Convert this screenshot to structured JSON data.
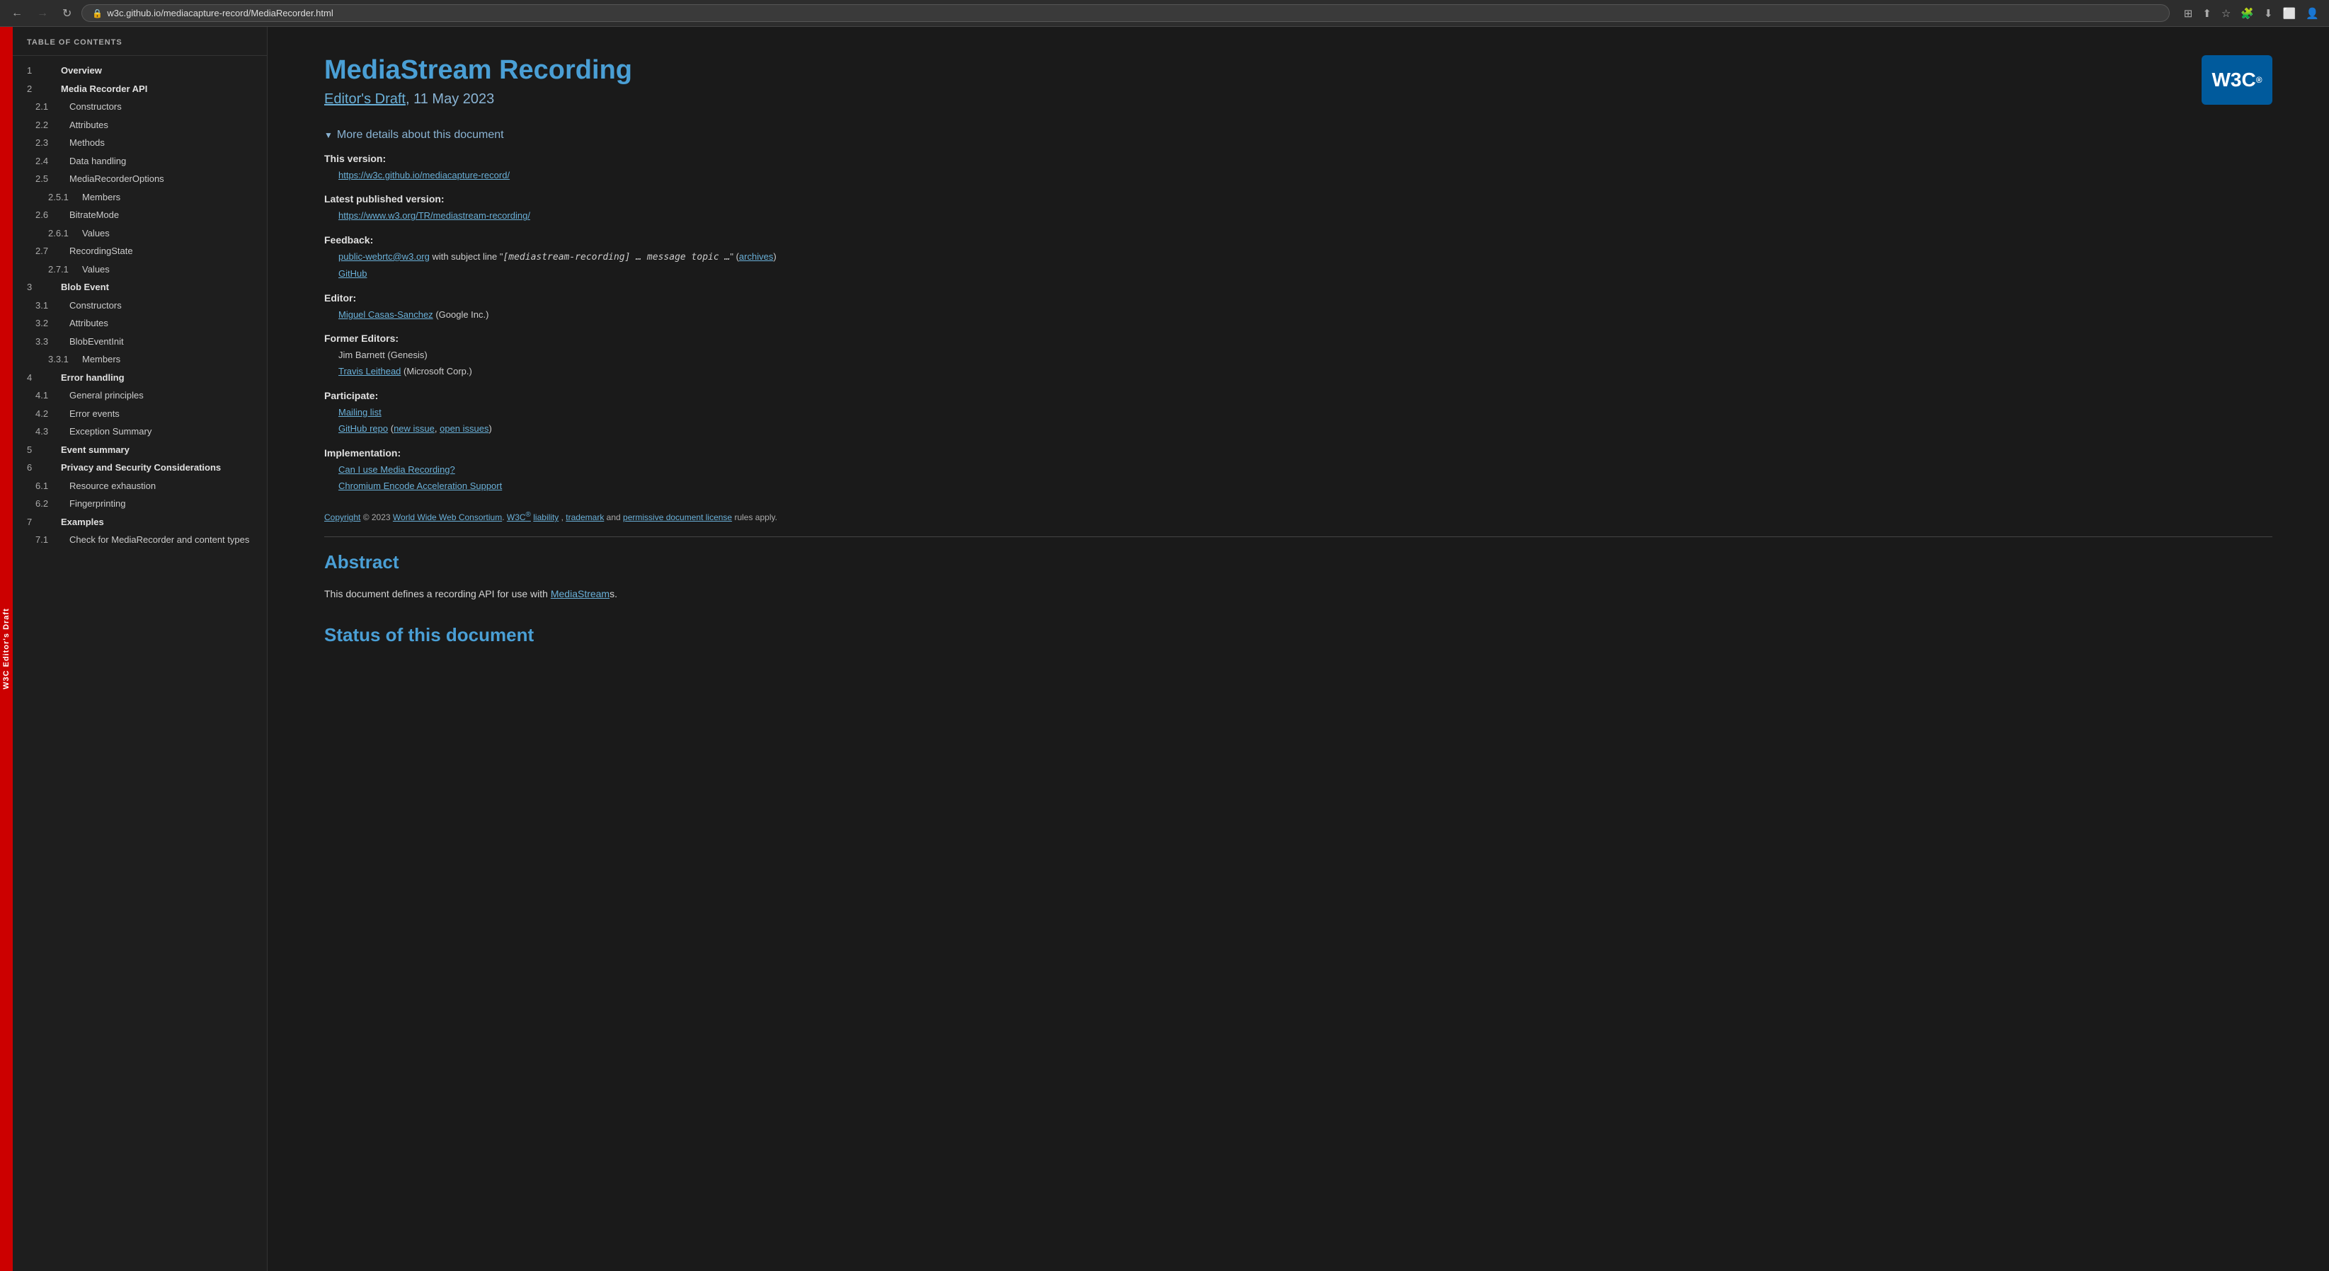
{
  "browser": {
    "url": "w3c.github.io/mediacapture-record/MediaRecorder.html",
    "back_btn": "←",
    "forward_btn": "→",
    "reload_btn": "↻"
  },
  "w3c_tab": {
    "lines": [
      "W",
      "3",
      "C",
      " ",
      "E",
      "d",
      "i",
      "t",
      "o",
      "r",
      "'",
      "s",
      " ",
      "D",
      "r",
      "a",
      "f",
      "t"
    ],
    "label": "W3C Editor's Draft"
  },
  "toc": {
    "title": "TABLE OF CONTENTS",
    "items": [
      {
        "num": "1",
        "label": "Overview",
        "level": "top"
      },
      {
        "num": "2",
        "label": "Media Recorder API",
        "level": "top"
      },
      {
        "num": "2.1",
        "label": "Constructors",
        "level": "sub"
      },
      {
        "num": "2.2",
        "label": "Attributes",
        "level": "sub"
      },
      {
        "num": "2.3",
        "label": "Methods",
        "level": "sub"
      },
      {
        "num": "2.4",
        "label": "Data handling",
        "level": "sub"
      },
      {
        "num": "2.5",
        "label": "MediaRecorderOptions",
        "level": "sub"
      },
      {
        "num": "2.5.1",
        "label": "Members",
        "level": "sub2"
      },
      {
        "num": "2.6",
        "label": "BitrateMode",
        "level": "sub"
      },
      {
        "num": "2.6.1",
        "label": "Values",
        "level": "sub2"
      },
      {
        "num": "2.7",
        "label": "RecordingState",
        "level": "sub"
      },
      {
        "num": "2.7.1",
        "label": "Values",
        "level": "sub2"
      },
      {
        "num": "3",
        "label": "Blob Event",
        "level": "top"
      },
      {
        "num": "3.1",
        "label": "Constructors",
        "level": "sub"
      },
      {
        "num": "3.2",
        "label": "Attributes",
        "level": "sub"
      },
      {
        "num": "3.3",
        "label": "BlobEventInit",
        "level": "sub"
      },
      {
        "num": "3.3.1",
        "label": "Members",
        "level": "sub2"
      },
      {
        "num": "4",
        "label": "Error handling",
        "level": "top"
      },
      {
        "num": "4.1",
        "label": "General principles",
        "level": "sub"
      },
      {
        "num": "4.2",
        "label": "Error events",
        "level": "sub"
      },
      {
        "num": "4.3",
        "label": "Exception Summary",
        "level": "sub"
      },
      {
        "num": "5",
        "label": "Event summary",
        "level": "top"
      },
      {
        "num": "6",
        "label": "Privacy and Security Considerations",
        "level": "top"
      },
      {
        "num": "6.1",
        "label": "Resource exhaustion",
        "level": "sub"
      },
      {
        "num": "6.2",
        "label": "Fingerprinting",
        "level": "sub"
      },
      {
        "num": "7",
        "label": "Examples",
        "level": "top"
      },
      {
        "num": "7.1",
        "label": "Check for MediaRecorder and content types",
        "level": "sub"
      }
    ]
  },
  "doc": {
    "title": "MediaStream Recording",
    "draft_label": "Editor's Draft",
    "draft_date": "11 May 2023",
    "details_toggle": "More details about this document",
    "this_version_label": "This version:",
    "this_version_url": "https://w3c.github.io/mediacapture-record/",
    "latest_version_label": "Latest published version:",
    "latest_version_url": "https://www.w3.org/TR/mediastream-recording/",
    "feedback_label": "Feedback:",
    "feedback_email": "public-webrtc@w3.org",
    "feedback_subject": "[mediastream-recording] … message topic …",
    "feedback_archives": "archives",
    "feedback_github": "GitHub",
    "editor_label": "Editor:",
    "editor_name": "Miguel Casas-Sanchez",
    "editor_org": "(Google Inc.)",
    "former_editors_label": "Former Editors:",
    "former_editor1_name": "Jim Barnett",
    "former_editor1_org": "(Genesis)",
    "former_editor2_name": "Travis Leithead",
    "former_editor2_org": "(Microsoft Corp.)",
    "participate_label": "Participate:",
    "mailing_list": "Mailing list",
    "github_repo": "GitHub repo",
    "new_issue": "new issue",
    "open_issues": "open issues",
    "implementation_label": "Implementation:",
    "impl_link1": "Can I use Media Recording?",
    "impl_link2": "Chromium Encode Acceleration Support",
    "copyright_text": "Copyright",
    "copyright_year": "© 2023",
    "copyright_org": "World Wide Web Consortium",
    "copyright_w3c": "W3C",
    "copyright_liability": "liability",
    "copyright_trademark": "trademark",
    "copyright_license": "permissive document license",
    "copyright_suffix": "rules apply.",
    "abstract_title": "Abstract",
    "abstract_text": "This document defines a recording API for use with",
    "abstract_link": "MediaStream",
    "abstract_suffix": "s.",
    "status_title": "Status of this document"
  },
  "w3c_logo": {
    "text": "W3C",
    "sup": "®"
  }
}
